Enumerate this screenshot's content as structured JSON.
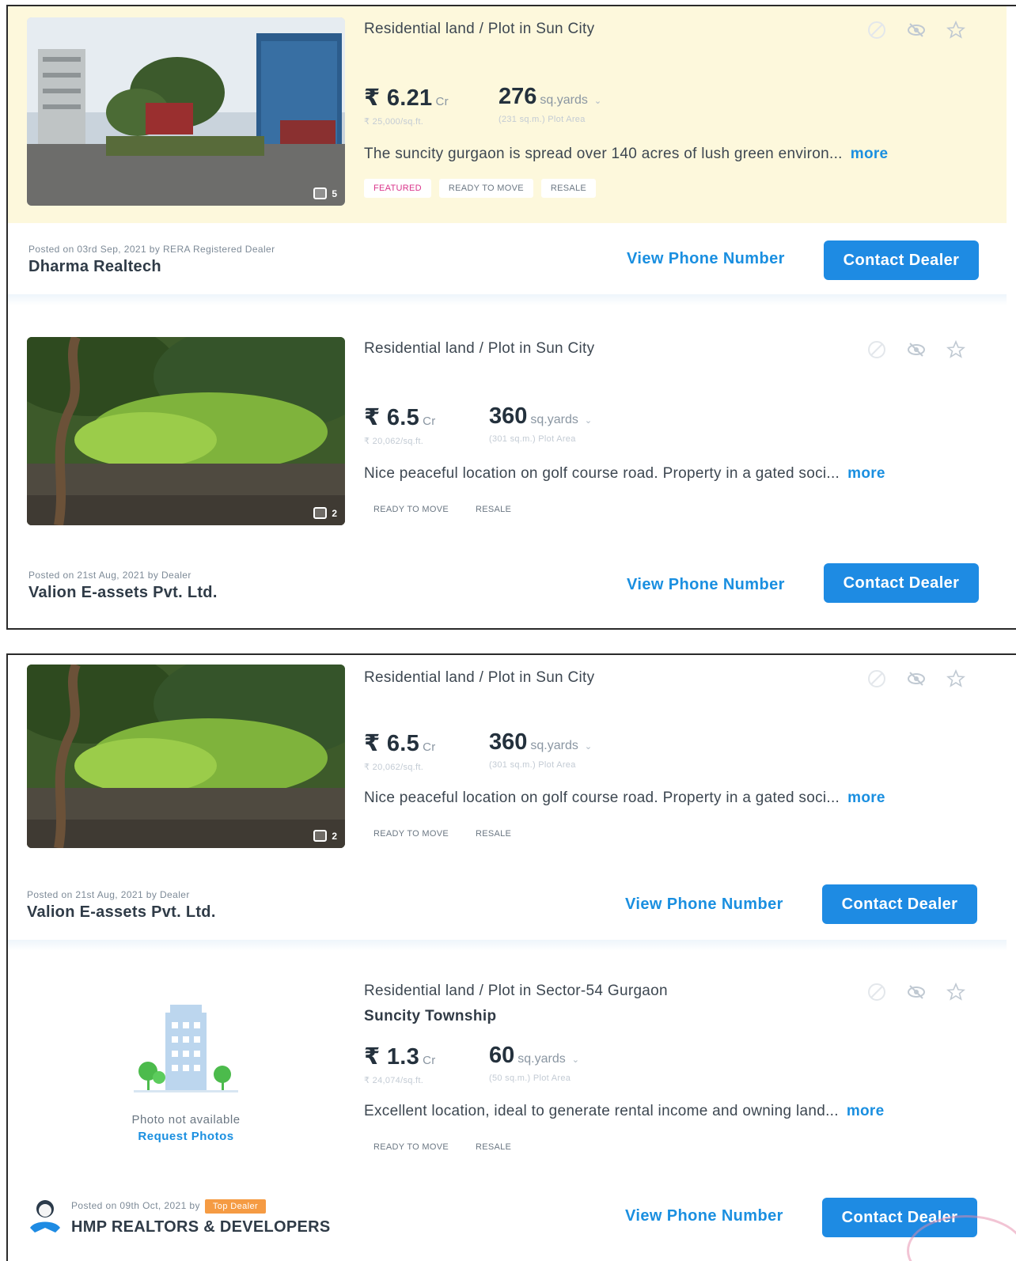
{
  "colors": {
    "accent": "#1e8be3",
    "featured_bg": "#fdf8dc",
    "featured_tag": "#d9338a",
    "top_dealer": "#f59b43"
  },
  "listings": [
    {
      "title": "Residential land / Plot in Sun City",
      "price": "₹ 6.21",
      "price_unit": "Cr",
      "price_per": "₹ 25,000/sq.ft.",
      "area": "276",
      "area_unit": "sq.yards",
      "area_sub": "(231 sq.m.) Plot Area",
      "description": "The suncity gurgaon is spread over 140 acres of lush green environ...",
      "more": "more",
      "tags": [
        "FEATURED",
        "READY TO MOVE",
        "RESALE"
      ],
      "photo_count": "5",
      "posted": "Posted on 03rd Sep, 2021 by RERA Registered Dealer",
      "dealer": "Dharma Realtech",
      "view_phone": "View Phone Number",
      "contact": "Contact Dealer"
    },
    {
      "title": "Residential land / Plot in Sun City",
      "price": "₹ 6.5",
      "price_unit": "Cr",
      "price_per": "₹ 20,062/sq.ft.",
      "area": "360",
      "area_unit": "sq.yards",
      "area_sub": "(301 sq.m.) Plot Area",
      "description": "Nice peaceful location on golf course road. Property in a gated soci...",
      "more": "more",
      "tags": [
        "READY TO MOVE",
        "RESALE"
      ],
      "photo_count": "2",
      "posted": "Posted on 21st Aug, 2021 by Dealer",
      "dealer": "Valion E-assets Pvt. Ltd.",
      "view_phone": "View Phone Number",
      "contact": "Contact Dealer"
    },
    {
      "title": "Residential land / Plot in Sun City",
      "price": "₹ 6.5",
      "price_unit": "Cr",
      "price_per": "₹ 20,062/sq.ft.",
      "area": "360",
      "area_unit": "sq.yards",
      "area_sub": "(301 sq.m.) Plot Area",
      "description": "Nice peaceful location on golf course road. Property in a gated soci...",
      "more": "more",
      "tags": [
        "READY TO MOVE",
        "RESALE"
      ],
      "photo_count": "2",
      "posted": "Posted on 21st Aug, 2021 by Dealer",
      "dealer": "Valion E-assets Pvt. Ltd.",
      "view_phone": "View Phone Number",
      "contact": "Contact Dealer"
    },
    {
      "title": "Residential land / Plot in Sector-54 Gurgaon",
      "subtitle": "Suncity Township",
      "price": "₹ 1.3",
      "price_unit": "Cr",
      "price_per": "₹ 24,074/sq.ft.",
      "area": "60",
      "area_unit": "sq.yards",
      "area_sub": "(50 sq.m.) Plot Area",
      "description": "Excellent location, ideal to generate rental income and owning land...",
      "more": "more",
      "tags": [
        "READY TO MOVE",
        "RESALE"
      ],
      "no_photo_text": "Photo not available",
      "request_photos": "Request Photos",
      "posted": "Posted on 09th Oct, 2021 by",
      "badge": "Top Dealer",
      "dealer": "HMP REALTORS & DEVELOPERS",
      "view_phone": "View Phone Number",
      "contact": "Contact Dealer"
    }
  ]
}
